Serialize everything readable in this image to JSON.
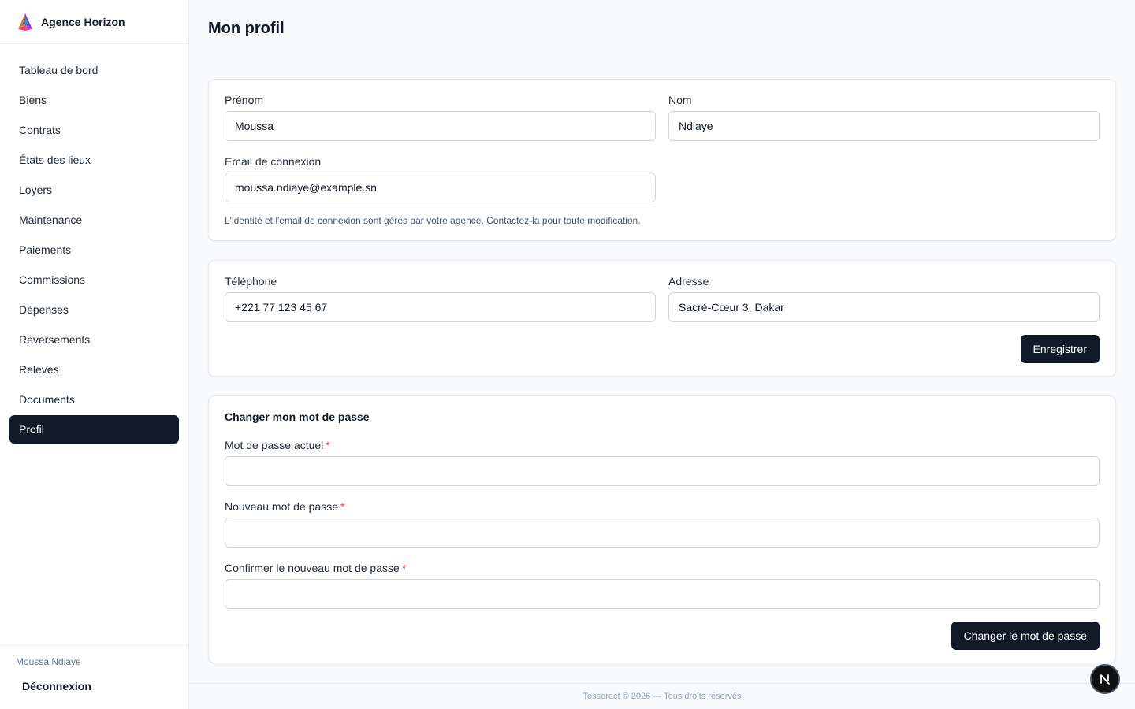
{
  "brand": {
    "name": "Agence Horizon"
  },
  "nav": {
    "items": [
      {
        "label": "Tableau de bord"
      },
      {
        "label": "Biens"
      },
      {
        "label": "Contrats"
      },
      {
        "label": "États des lieux"
      },
      {
        "label": "Loyers"
      },
      {
        "label": "Maintenance"
      },
      {
        "label": "Paiements"
      },
      {
        "label": "Commissions"
      },
      {
        "label": "Dépenses"
      },
      {
        "label": "Reversements"
      },
      {
        "label": "Relevés"
      },
      {
        "label": "Documents"
      },
      {
        "label": "Profil",
        "active": true
      }
    ]
  },
  "user": {
    "name": "Moussa Ndiaye",
    "logout_label": "Déconnexion"
  },
  "page": {
    "title": "Mon profil"
  },
  "identity": {
    "first_name_label": "Prénom",
    "first_name_value": "Moussa",
    "last_name_label": "Nom",
    "last_name_value": "Ndiaye",
    "email_label": "Email de connexion",
    "email_value": "moussa.ndiaye@example.sn",
    "helper": "L'identité et l'email de connexion sont gérés par votre agence. Contactez-la pour toute modification."
  },
  "contact": {
    "phone_label": "Téléphone",
    "phone_value": "+221 77 123 45 67",
    "address_label": "Adresse",
    "address_value": "Sacré-Cœur 3, Dakar",
    "save_label": "Enregistrer"
  },
  "password": {
    "title": "Changer mon mot de passe",
    "current_label": "Mot de passe actuel",
    "new_label": "Nouveau mot de passe",
    "confirm_label": "Confirmer le nouveau mot de passe",
    "required_marker": "*",
    "submit_label": "Changer le mot de passe"
  },
  "footer": {
    "text": "Tesseract © 2026 — Tous droits réservés"
  },
  "dev_badge": {
    "letter": "N"
  },
  "colors": {
    "primary": "#111827",
    "required": "#ef4444",
    "background": "#f8fafc"
  },
  "icons": {
    "brand": "brand-logo-icon",
    "dev_badge": "next-badge-icon"
  }
}
